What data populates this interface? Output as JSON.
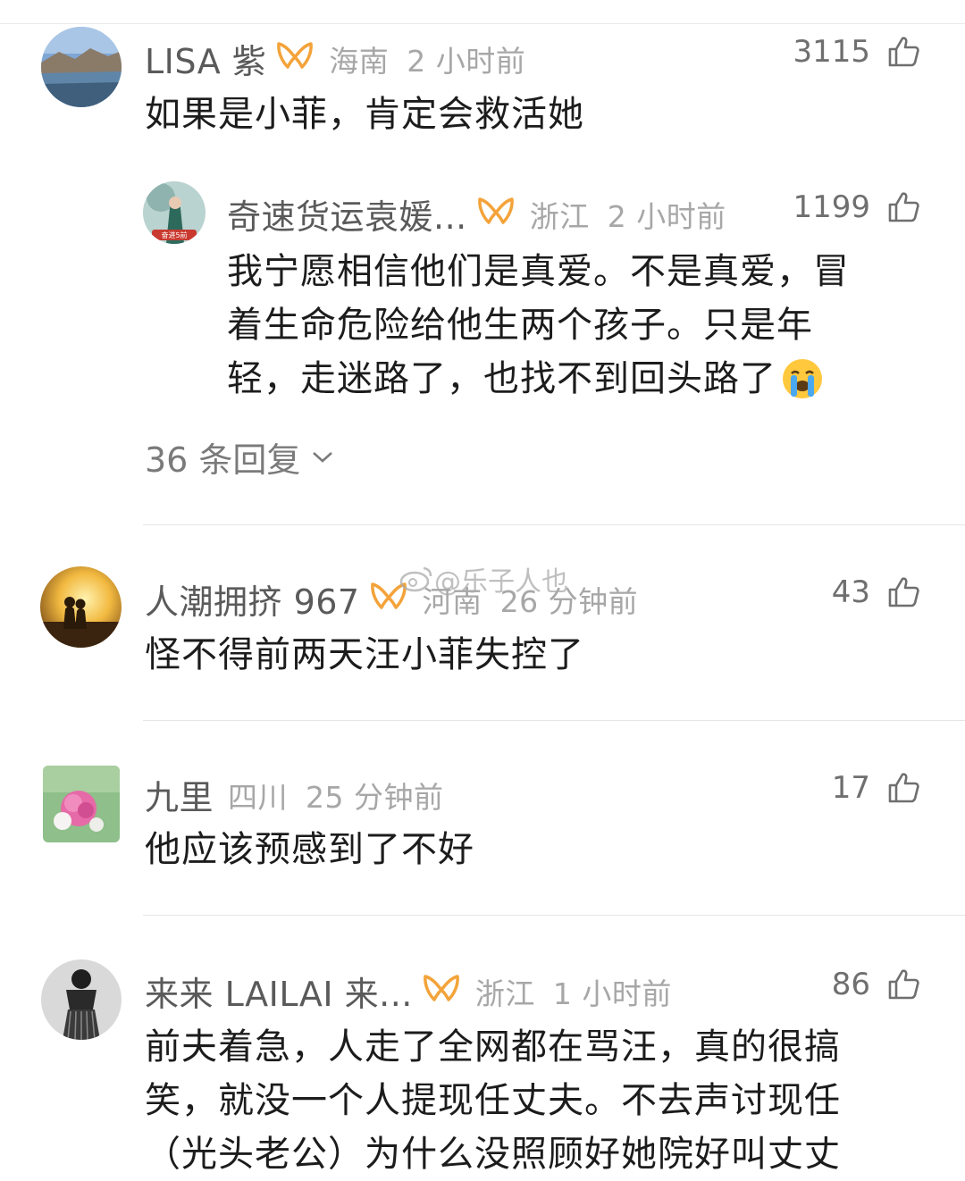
{
  "colors": {
    "username": "#5a5a5a",
    "meta": "#a7a7a7",
    "text": "#1c1c1c",
    "badge": "#f3a33a"
  },
  "watermark": "@乐子人也",
  "comments": [
    {
      "username": "LISA 紫",
      "badge": "vip-ribbon-icon",
      "location": "海南",
      "time": "2 小时前",
      "likes": "3115",
      "text": "如果是小菲，肯定会救活她",
      "reply": {
        "username": "奇速货运袁媛...",
        "badge": "vip-ribbon-icon",
        "location": "浙江",
        "time": "2 小时前",
        "likes": "1199",
        "lines": [
          "我宁愿相信他们是真爱。不是真爱，冒",
          "着生命危险给他生两个孩子。只是年",
          "轻，走迷路了，也找不到回头路了"
        ],
        "avatar_caption": "奋进5前"
      },
      "replies_label": "36 条回复"
    },
    {
      "username": "人潮拥挤 967",
      "badge": "vip-ribbon-icon",
      "location": "河南",
      "time": "26 分钟前",
      "likes": "43",
      "text": "怪不得前两天汪小菲失控了"
    },
    {
      "username": "九里",
      "location": "四川",
      "time": "25 分钟前",
      "likes": "17",
      "text": "他应该预感到了不好"
    },
    {
      "username": "来来 LAILAI 来...",
      "badge": "vip-ribbon-icon",
      "location": "浙江",
      "time": "1 小时前",
      "likes": "86",
      "lines": [
        "前夫着急，人走了全网都在骂汪，真的很搞",
        "笑，就没一个人提现任丈夫。不去声讨现任",
        "（光头老公）为什么没照顾好她院好叫丈丈"
      ]
    }
  ]
}
